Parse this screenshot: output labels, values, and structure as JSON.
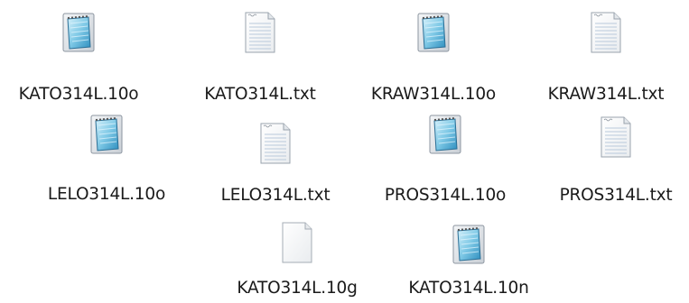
{
  "files": [
    {
      "name": "KATO314L.10o",
      "icon": "notepad-file-icon"
    },
    {
      "name": "KATO314L.txt",
      "icon": "text-file-icon"
    },
    {
      "name": "KRAW314L.10o",
      "icon": "notepad-file-icon"
    },
    {
      "name": "KRAW314L.txt",
      "icon": "text-file-icon"
    },
    {
      "name": "LELO314L.10o",
      "icon": "notepad-file-icon"
    },
    {
      "name": "LELO314L.txt",
      "icon": "text-file-icon"
    },
    {
      "name": "PROS314L.10o",
      "icon": "notepad-file-icon"
    },
    {
      "name": "PROS314L.txt",
      "icon": "text-file-icon"
    },
    {
      "name": "KATO314L.10g",
      "icon": "blank-file-icon"
    },
    {
      "name": "KATO314L.10n",
      "icon": "notepad-file-icon"
    }
  ]
}
